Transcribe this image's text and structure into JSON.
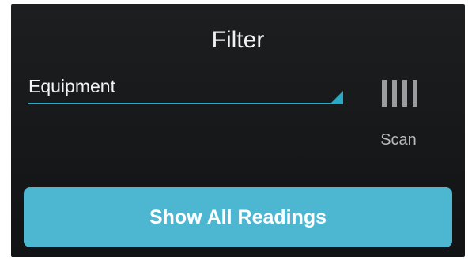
{
  "header": {
    "title": "Filter"
  },
  "filter": {
    "dropdown": {
      "selected_value": "Equipment"
    },
    "scan": {
      "label": "Scan",
      "icon": "scan-barcode-icon"
    }
  },
  "actions": {
    "show_all_readings_label": "Show All Readings"
  },
  "colors": {
    "background": "#16181a",
    "accent": "#2aa9c6",
    "button": "#4db7d1",
    "text": "#f2f2f2",
    "muted_text": "#b8b9bb"
  }
}
